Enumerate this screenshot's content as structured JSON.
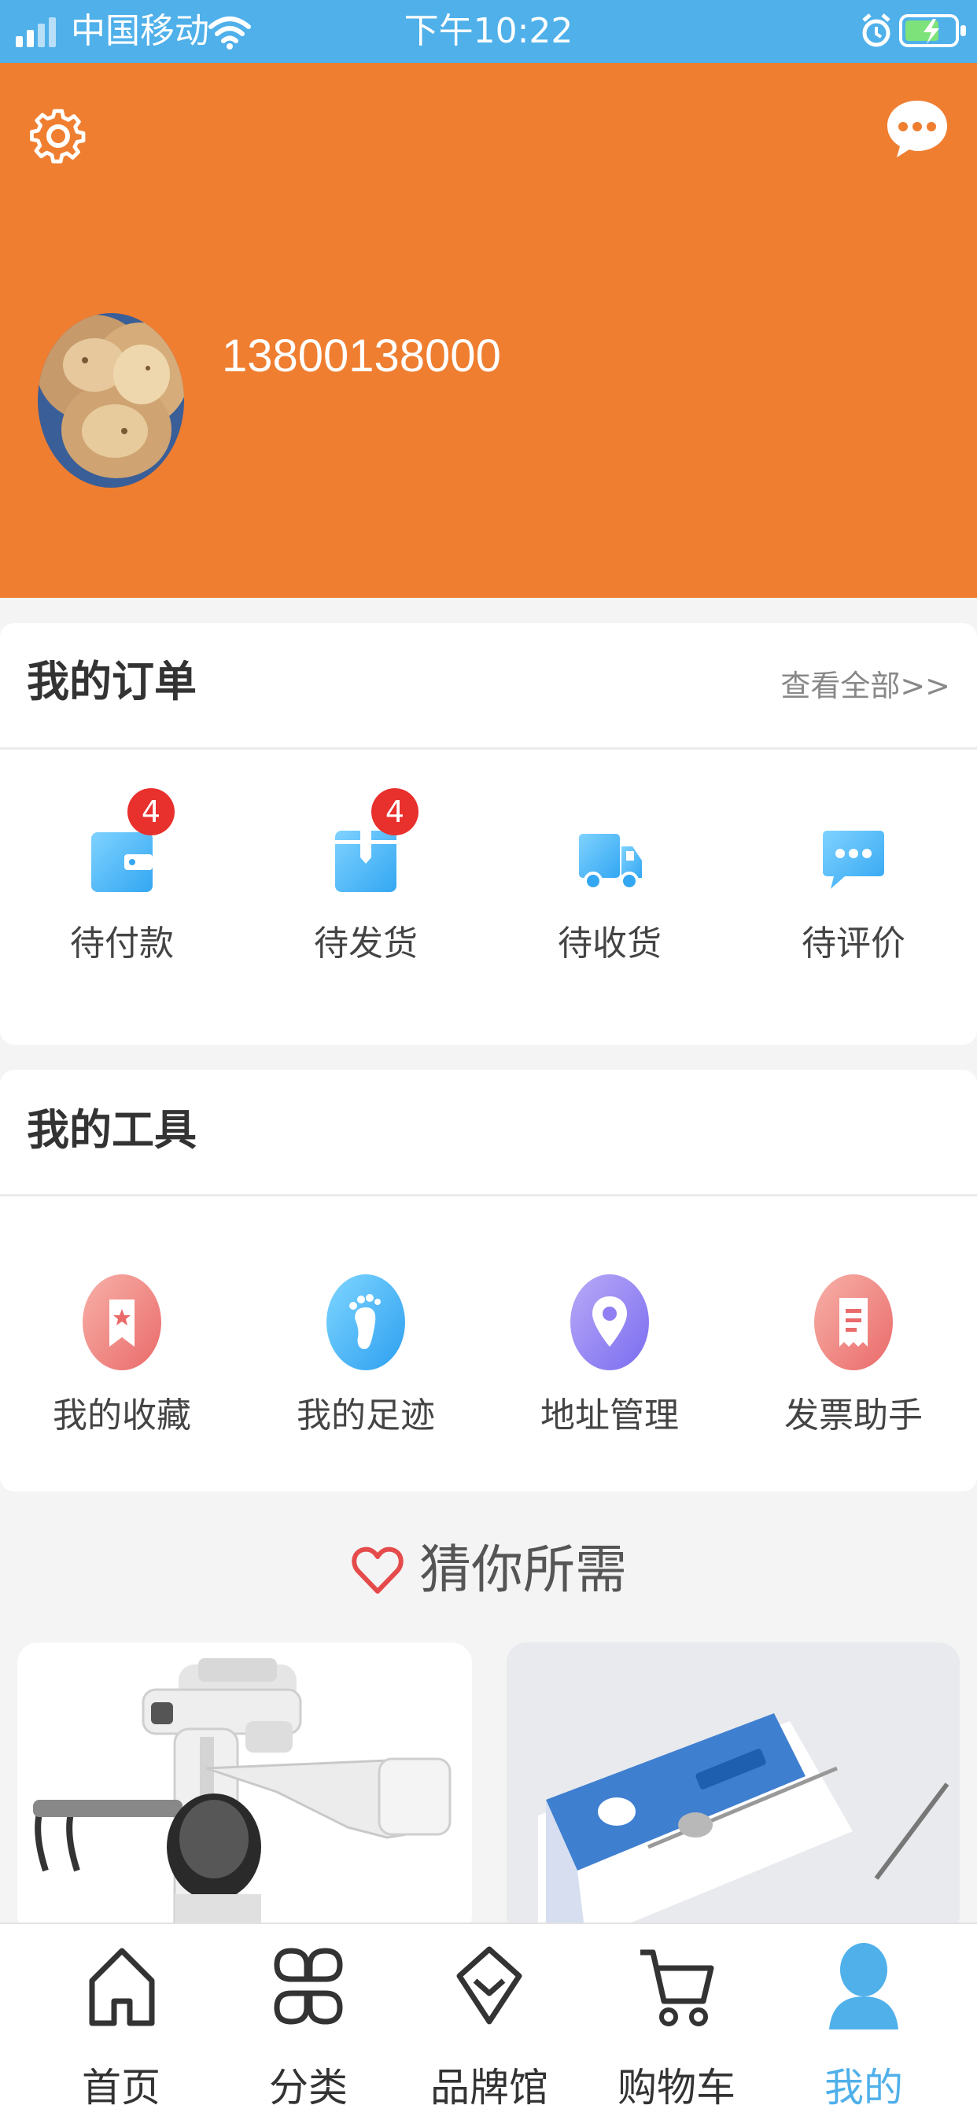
{
  "status_bar": {
    "carrier": "中国移动",
    "time": "下午10:22"
  },
  "profile": {
    "phone": "13800138000"
  },
  "orders": {
    "title": "我的订单",
    "view_all": "查看全部>>",
    "items": [
      {
        "label": "待付款",
        "badge": "4",
        "icon": "wallet-icon"
      },
      {
        "label": "待发货",
        "badge": "4",
        "icon": "package-icon"
      },
      {
        "label": "待收货",
        "icon": "truck-icon"
      },
      {
        "label": "待评价",
        "icon": "comment-icon"
      }
    ]
  },
  "tools": {
    "title": "我的工具",
    "items": [
      {
        "label": "我的收藏",
        "icon": "bookmark-star-icon"
      },
      {
        "label": "我的足迹",
        "icon": "footprint-icon"
      },
      {
        "label": "地址管理",
        "icon": "location-pin-icon"
      },
      {
        "label": "发票助手",
        "icon": "receipt-icon"
      }
    ]
  },
  "recommend": {
    "title": "猜你所需"
  },
  "tabbar": {
    "items": [
      {
        "label": "首页",
        "icon": "home-icon"
      },
      {
        "label": "分类",
        "icon": "category-icon"
      },
      {
        "label": "品牌馆",
        "icon": "brand-icon"
      },
      {
        "label": "购物车",
        "icon": "cart-icon"
      },
      {
        "label": "我的",
        "icon": "user-icon",
        "active": true
      }
    ]
  },
  "colors": {
    "header": "#ef7e31",
    "status_bar": "#4fb0ea",
    "badge": "#e8302d",
    "active_tab": "#4fb0ea"
  }
}
